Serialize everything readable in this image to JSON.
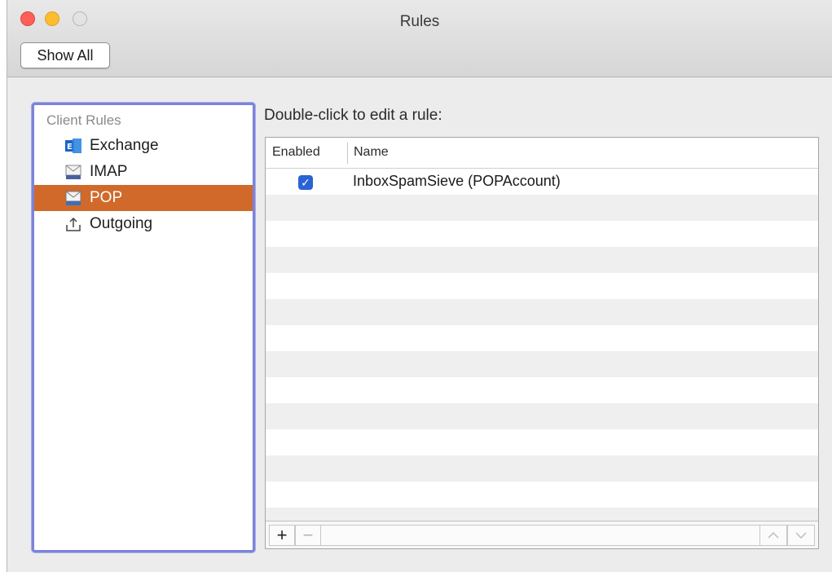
{
  "window": {
    "title": "Rules"
  },
  "toolbar": {
    "show_all_label": "Show All"
  },
  "sidebar": {
    "header": "Client Rules",
    "items": [
      {
        "label": "Exchange",
        "icon": "exchange-icon",
        "selected": false
      },
      {
        "label": "IMAP",
        "icon": "imap-mail-icon",
        "selected": false
      },
      {
        "label": "POP",
        "icon": "pop-mail-icon",
        "selected": true
      },
      {
        "label": "Outgoing",
        "icon": "outgoing-upload-icon",
        "selected": false
      }
    ]
  },
  "main": {
    "prompt": "Double-click to edit a rule:",
    "table": {
      "columns": [
        "Enabled",
        "Name"
      ],
      "rows": [
        {
          "enabled": true,
          "name": "InboxSpamSieve (POPAccount)"
        }
      ]
    },
    "footer": {
      "add_label": "+",
      "remove_label": "−"
    }
  },
  "colors": {
    "selected_item": "#d0692a",
    "focus_ring": "#7b83d9",
    "checkbox": "#2a63d3"
  }
}
